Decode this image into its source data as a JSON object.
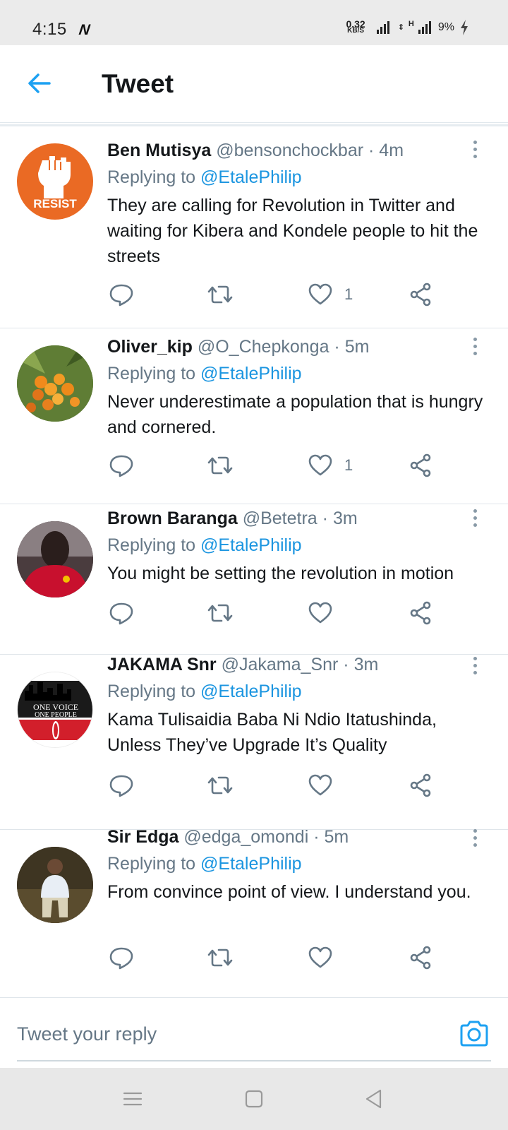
{
  "status_bar": {
    "time": "4:15",
    "notification_icon": "N",
    "speed_value": "0.32",
    "speed_unit": "KB/S",
    "network_type": "H",
    "battery": "9%"
  },
  "header": {
    "title": "Tweet"
  },
  "tweets": [
    {
      "name": "Ben Mutisya",
      "handle": "@bensonchockbar",
      "time": "4m",
      "replying_prefix": "Replying to ",
      "replying_to": "@EtalePhilip",
      "text": "They are calling for Revolution in Twitter and waiting for Kibera and Kondele people to hit the streets",
      "likes": "1",
      "avatar_text": "RESIST"
    },
    {
      "name": "Oliver_kip",
      "handle": "@O_Chepkonga",
      "time": "5m",
      "replying_prefix": "Replying to ",
      "replying_to": "@EtalePhilip",
      "text": "Never underestimate a population that is hungry and cornered.",
      "likes": "1"
    },
    {
      "name": "Brown Baranga",
      "handle": "@Betetra",
      "time": "3m",
      "replying_prefix": "Replying to ",
      "replying_to": "@EtalePhilip",
      "text": "You might be setting the revolution in motion",
      "likes": ""
    },
    {
      "name": "JAKAMA Snr",
      "handle": "@Jakama_Snr",
      "time": "3m",
      "replying_prefix": "Replying to ",
      "replying_to": "@EtalePhilip",
      "text": "Kama Tulisaidia Baba Ni Ndio Itatushinda, Unless They’ve Upgrade It’s Quality",
      "likes": "",
      "avatar_text_line1": "ONE VOICE",
      "avatar_text_line2": "ONE PEOPLE"
    },
    {
      "name": "Sir Edga",
      "handle": "@edga_omondi",
      "time": "5m",
      "replying_prefix": "Replying to ",
      "replying_to": "@EtalePhilip",
      "text": "From convince point of view. I understand you.",
      "likes": ""
    }
  ],
  "reply_bar": {
    "placeholder": "Tweet your reply"
  },
  "icons": {
    "accent": "#1da1f2",
    "action_gray": "#657786"
  }
}
